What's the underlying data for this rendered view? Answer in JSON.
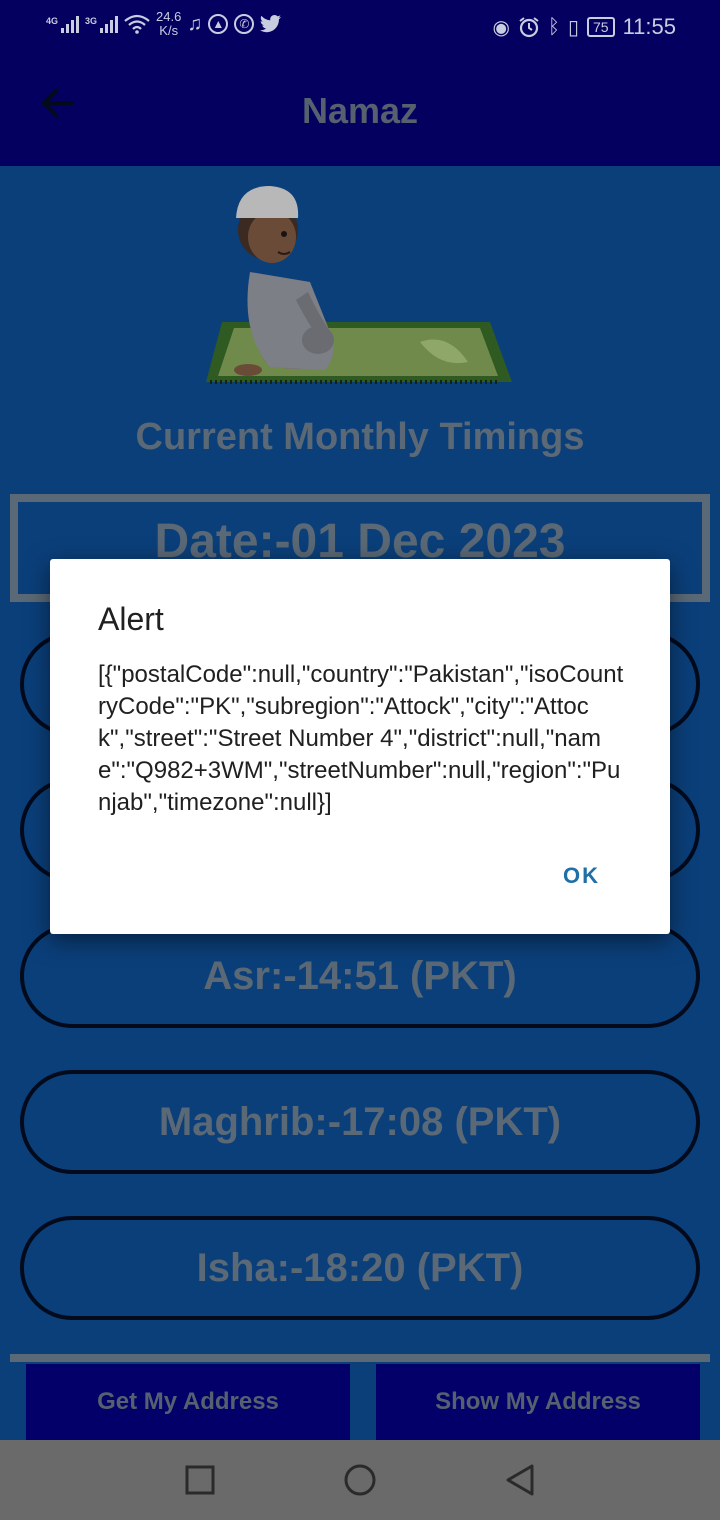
{
  "status_bar": {
    "network1": "4G",
    "network2": "3G",
    "speed_value": "24.6",
    "speed_unit": "K/s",
    "battery": "75",
    "time": "11:55"
  },
  "app_bar": {
    "title": "Namaz"
  },
  "main": {
    "section_title": "Current Monthly Timings",
    "date": "Date:-01 Dec 2023",
    "prayers": [
      {
        "label": ""
      },
      {
        "label": ""
      },
      {
        "label": "Asr:-14:51 (PKT)"
      },
      {
        "label": "Maghrib:-17:08 (PKT)"
      },
      {
        "label": "Isha:-18:20 (PKT)"
      }
    ],
    "get_address_label": "Get My Address",
    "show_address_label": "Show My Address"
  },
  "dialog": {
    "title": "Alert",
    "message": "[{\"postalCode\":null,\"country\":\"Pakistan\",\"isoCountryCode\":\"PK\",\"subregion\":\"Attock\",\"city\":\"Attock\",\"street\":\"Street Number 4\",\"district\":null,\"name\":\"Q982+3WM\",\"streetNumber\":null,\"region\":\"Punjab\",\"timezone\":null}]",
    "ok_label": "OK"
  },
  "colors": {
    "scrim_app_bar": "#04005f",
    "scrim_content": "#0b3f7a",
    "dialog_accent": "#1f6fa8"
  }
}
